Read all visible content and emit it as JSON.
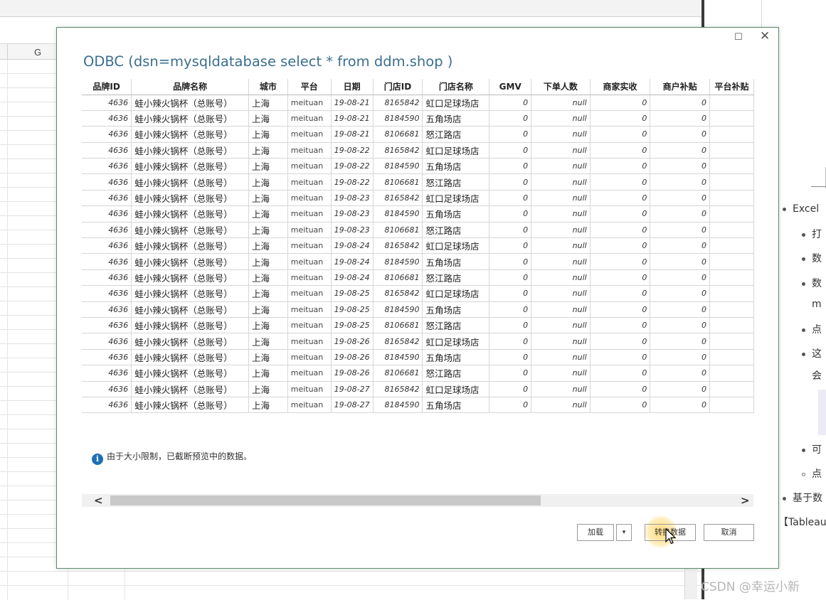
{
  "excel": {
    "column_label": "G",
    "dropdown_glyph": "⌄"
  },
  "right_panel": {
    "lines": [
      {
        "text": "Excel",
        "bullet": "solid"
      },
      {
        "text": "打",
        "bullet": "solid"
      },
      {
        "text": "数",
        "bullet": "solid"
      },
      {
        "text": "数",
        "bullet": "solid"
      },
      {
        "text": "m",
        "bullet": "none"
      },
      {
        "text": "点",
        "bullet": "solid"
      },
      {
        "text": "这",
        "bullet": "solid"
      },
      {
        "text": "会",
        "bullet": "none"
      },
      {
        "text": "可",
        "bullet": "solid"
      },
      {
        "text": "点",
        "bullet": "hollow"
      },
      {
        "text": "基于数",
        "bullet": "solid"
      },
      {
        "text": "【Tableau",
        "bullet": "none"
      }
    ],
    "watermark": "CSDN @幸运小新"
  },
  "dialog": {
    "window_max_glyph": "☐",
    "window_close_glyph": "✕",
    "title": "ODBC (dsn=mysqldatabase select * from ddm.shop )",
    "columns": [
      "品牌ID",
      "品牌名称",
      "城市",
      "平台",
      "日期",
      "门店ID",
      "门店名称",
      "GMV",
      "下单人数",
      "商家实收",
      "商户补贴",
      "平台补贴"
    ],
    "rows": [
      [
        "4636",
        "蛙小辣火锅杯（总账号）",
        "上海",
        "meituan",
        "19-08-21",
        "8165842",
        "虹口足球场店",
        "0",
        "null",
        "0",
        "0",
        ""
      ],
      [
        "4636",
        "蛙小辣火锅杯（总账号）",
        "上海",
        "meituan",
        "19-08-21",
        "8184590",
        "五角场店",
        "0",
        "null",
        "0",
        "0",
        ""
      ],
      [
        "4636",
        "蛙小辣火锅杯（总账号）",
        "上海",
        "meituan",
        "19-08-21",
        "8106681",
        "怒江路店",
        "0",
        "null",
        "0",
        "0",
        ""
      ],
      [
        "4636",
        "蛙小辣火锅杯（总账号）",
        "上海",
        "meituan",
        "19-08-22",
        "8165842",
        "虹口足球场店",
        "0",
        "null",
        "0",
        "0",
        ""
      ],
      [
        "4636",
        "蛙小辣火锅杯（总账号）",
        "上海",
        "meituan",
        "19-08-22",
        "8184590",
        "五角场店",
        "0",
        "null",
        "0",
        "0",
        ""
      ],
      [
        "4636",
        "蛙小辣火锅杯（总账号）",
        "上海",
        "meituan",
        "19-08-22",
        "8106681",
        "怒江路店",
        "0",
        "null",
        "0",
        "0",
        ""
      ],
      [
        "4636",
        "蛙小辣火锅杯（总账号）",
        "上海",
        "meituan",
        "19-08-23",
        "8165842",
        "虹口足球场店",
        "0",
        "null",
        "0",
        "0",
        ""
      ],
      [
        "4636",
        "蛙小辣火锅杯（总账号）",
        "上海",
        "meituan",
        "19-08-23",
        "8184590",
        "五角场店",
        "0",
        "null",
        "0",
        "0",
        ""
      ],
      [
        "4636",
        "蛙小辣火锅杯（总账号）",
        "上海",
        "meituan",
        "19-08-23",
        "8106681",
        "怒江路店",
        "0",
        "null",
        "0",
        "0",
        ""
      ],
      [
        "4636",
        "蛙小辣火锅杯（总账号）",
        "上海",
        "meituan",
        "19-08-24",
        "8165842",
        "虹口足球场店",
        "0",
        "null",
        "0",
        "0",
        ""
      ],
      [
        "4636",
        "蛙小辣火锅杯（总账号）",
        "上海",
        "meituan",
        "19-08-24",
        "8184590",
        "五角场店",
        "0",
        "null",
        "0",
        "0",
        ""
      ],
      [
        "4636",
        "蛙小辣火锅杯（总账号）",
        "上海",
        "meituan",
        "19-08-24",
        "8106681",
        "怒江路店",
        "0",
        "null",
        "0",
        "0",
        ""
      ],
      [
        "4636",
        "蛙小辣火锅杯（总账号）",
        "上海",
        "meituan",
        "19-08-25",
        "8165842",
        "虹口足球场店",
        "0",
        "null",
        "0",
        "0",
        ""
      ],
      [
        "4636",
        "蛙小辣火锅杯（总账号）",
        "上海",
        "meituan",
        "19-08-25",
        "8184590",
        "五角场店",
        "0",
        "null",
        "0",
        "0",
        ""
      ],
      [
        "4636",
        "蛙小辣火锅杯（总账号）",
        "上海",
        "meituan",
        "19-08-25",
        "8106681",
        "怒江路店",
        "0",
        "null",
        "0",
        "0",
        ""
      ],
      [
        "4636",
        "蛙小辣火锅杯（总账号）",
        "上海",
        "meituan",
        "19-08-26",
        "8165842",
        "虹口足球场店",
        "0",
        "null",
        "0",
        "0",
        ""
      ],
      [
        "4636",
        "蛙小辣火锅杯（总账号）",
        "上海",
        "meituan",
        "19-08-26",
        "8184590",
        "五角场店",
        "0",
        "null",
        "0",
        "0",
        ""
      ],
      [
        "4636",
        "蛙小辣火锅杯（总账号）",
        "上海",
        "meituan",
        "19-08-26",
        "8106681",
        "怒江路店",
        "0",
        "null",
        "0",
        "0",
        ""
      ],
      [
        "4636",
        "蛙小辣火锅杯（总账号）",
        "上海",
        "meituan",
        "19-08-27",
        "8165842",
        "虹口足球场店",
        "0",
        "null",
        "0",
        "0",
        ""
      ],
      [
        "4636",
        "蛙小辣火锅杯（总账号）",
        "上海",
        "meituan",
        "19-08-27",
        "8184590",
        "五角场店",
        "0",
        "null",
        "0",
        "0",
        ""
      ]
    ],
    "notice": "由于大小限制，已截断预览中的数据。",
    "info_glyph": "i",
    "scroll_left_glyph": "<",
    "scroll_right_glyph": ">",
    "buttons": {
      "load": "加载",
      "load_arrow": "▾",
      "transform": "转换数据",
      "cancel": "取消"
    }
  },
  "colors": {
    "title_blue": "#3b6f8f",
    "info_blue": "#1f6fb5",
    "click_halo": "#ffd666"
  }
}
